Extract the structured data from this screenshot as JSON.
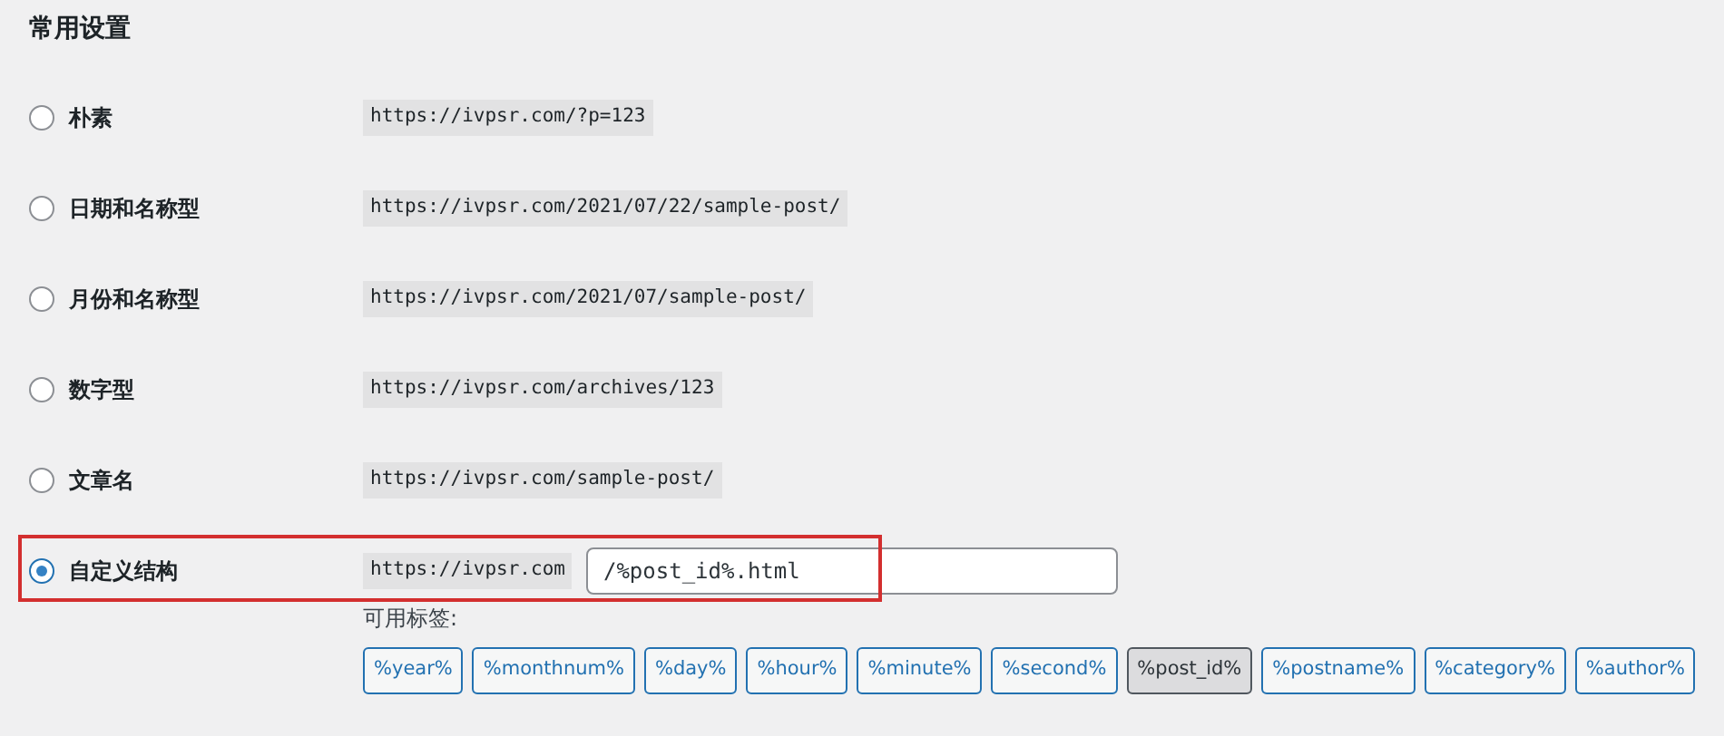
{
  "section_title": "常用设置",
  "options": [
    {
      "label": "朴素",
      "example": "https://ivpsr.com/?p=123",
      "selected": false,
      "highlighted": false
    },
    {
      "label": "日期和名称型",
      "example": "https://ivpsr.com/2021/07/22/sample-post/",
      "selected": false,
      "highlighted": false
    },
    {
      "label": "月份和名称型",
      "example": "https://ivpsr.com/2021/07/sample-post/",
      "selected": false,
      "highlighted": false
    },
    {
      "label": "数字型",
      "example": "https://ivpsr.com/archives/123",
      "selected": false,
      "highlighted": false
    },
    {
      "label": "文章名",
      "example": "https://ivpsr.com/sample-post/",
      "selected": false,
      "highlighted": false
    },
    {
      "label": "自定义结构",
      "example": "https://ivpsr.com",
      "value": "/%post_id%.html",
      "selected": true,
      "highlighted": true
    }
  ],
  "tags_label": "可用标签:",
  "tags": [
    {
      "label": "%year%",
      "selected": false
    },
    {
      "label": "%monthnum%",
      "selected": false
    },
    {
      "label": "%day%",
      "selected": false
    },
    {
      "label": "%hour%",
      "selected": false
    },
    {
      "label": "%minute%",
      "selected": false
    },
    {
      "label": "%second%",
      "selected": false
    },
    {
      "label": "%post_id%",
      "selected": true
    },
    {
      "label": "%postname%",
      "selected": false
    },
    {
      "label": "%category%",
      "selected": false
    },
    {
      "label": "%author%",
      "selected": false
    }
  ]
}
